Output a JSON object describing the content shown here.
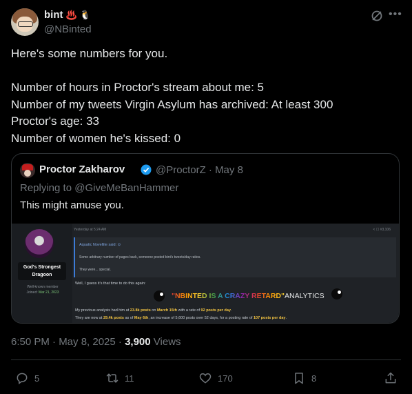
{
  "author": {
    "name": "bint",
    "name_emojis": "♨️ 🐧",
    "handle": "@NBinted"
  },
  "tweet_text": "Here's some numbers for you.\n\nNumber of hours in Proctor's stream about me: 5\nNumber of my tweets Virgin Asylum has archived: At least 300\nProctor's age: 33\nNumber of women he's kissed: 0",
  "quote": {
    "name": "Proctor Zakharov",
    "handle_date": "@ProctorZ · May 8",
    "reply_prefix": "Replying to",
    "reply_to": "@GiveMeBanHammer",
    "text": "This might amuse you.",
    "media": {
      "user_title_line1": "God's Strongest",
      "user_title_line2": "Dragoon",
      "member_status": "Well-known member",
      "joined_label": "Joined:",
      "joined_date": "Mar 21, 2023",
      "post_time": "Yesterday at 5:24 AM",
      "post_tools": "<  ☐  #3,106",
      "quoted_user": "Aquatic Novellite said: ⊙",
      "quoted_line1": "Some arbitrary number of pages back, someone posted bint's tweets/day ratios.",
      "quoted_line2": "They were... special.",
      "reply_line": "Well, I guess it's that time to do this again:",
      "banner_main": "\"NBINTED IS A CRAZY RETARD\"",
      "banner_suffix": "ANALYTICS",
      "analysis_1a": "My previous analysis had him at ",
      "analysis_1b": "23.8k posts",
      "analysis_1c": " on ",
      "analysis_1d": "March 15th",
      "analysis_1e": " with a rate of ",
      "analysis_1f": "92 posts per day",
      "analysis_1g": ".",
      "analysis_2a": "They are now at ",
      "analysis_2b": "29.4k posts",
      "analysis_2c": " as of ",
      "analysis_2d": "May 6th",
      "analysis_2e": ", an increase of 5,600 posts over 52 days, for a posting rate of ",
      "analysis_2f": "107 posts per day",
      "analysis_2g": "."
    }
  },
  "timestamp": "6:50 PM · May 8, 2025 · ",
  "views_count": "3,900",
  "views_label": " Views",
  "actions": {
    "replies": "5",
    "reposts": "11",
    "likes": "170",
    "bookmarks": "8"
  }
}
